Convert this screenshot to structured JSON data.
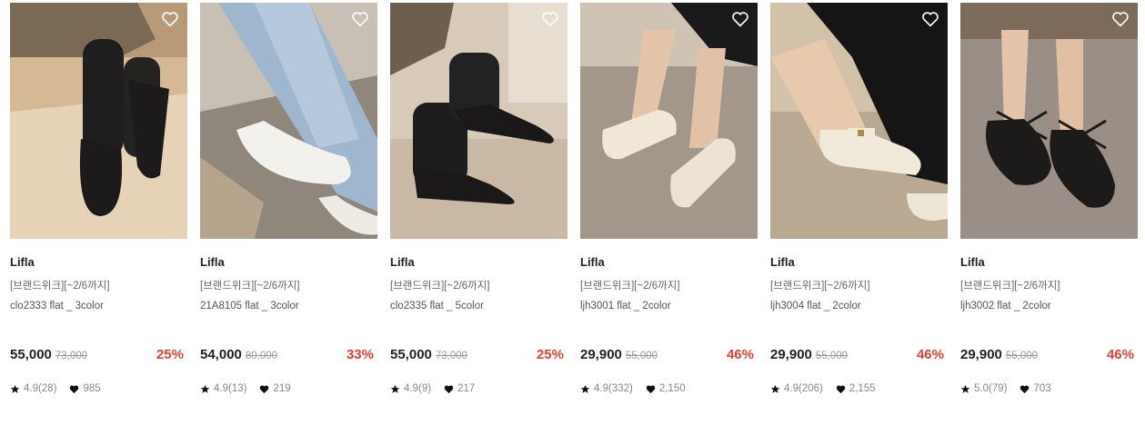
{
  "products": [
    {
      "brand": "Lifla",
      "event": "[브랜드위크][~2/6까지]",
      "name": "clo2333 flat _ 3color",
      "price": "55,000",
      "original_price": "73,000",
      "discount": "25%",
      "rating": "4.9(28)",
      "likes": "985",
      "shoe_color": "#1c1a1a",
      "bg": "#bfa88e"
    },
    {
      "brand": "Lifla",
      "event": "[브랜드위크][~2/6까지]",
      "name": "21A8105 flat _ 3color",
      "price": "54,000",
      "original_price": "80,000",
      "discount": "33%",
      "rating": "4.9(13)",
      "likes": "219",
      "shoe_color": "#f2f0ec",
      "bg": "#a9a199"
    },
    {
      "brand": "Lifla",
      "event": "[브랜드위크][~2/6까지]",
      "name": "clo2335 flat _ 5color",
      "price": "55,000",
      "original_price": "73,000",
      "discount": "25%",
      "rating": "4.9(9)",
      "likes": "217",
      "shoe_color": "#1a1818",
      "bg": "#c9b8a3"
    },
    {
      "brand": "Lifla",
      "event": "[브랜드위크][~2/6까지]",
      "name": "ljh3001 flat _ 2color",
      "price": "29,900",
      "original_price": "55,000",
      "discount": "46%",
      "rating": "4.9(332)",
      "likes": "2,150",
      "shoe_color": "#efe6d6",
      "bg": "#a3968a"
    },
    {
      "brand": "Lifla",
      "event": "[브랜드위크][~2/6까지]",
      "name": "ljh3004 flat _ 2color",
      "price": "29,900",
      "original_price": "55,000",
      "discount": "46%",
      "rating": "4.9(206)",
      "likes": "2,155",
      "shoe_color": "#f1ead9",
      "bg": "#b9a993"
    },
    {
      "brand": "Lifla",
      "event": "[브랜드위크][~2/6까지]",
      "name": "ljh3002 flat _ 2color",
      "price": "29,900",
      "original_price": "55,000",
      "discount": "46%",
      "rating": "5.0(79)",
      "likes": "703",
      "shoe_color": "#1d1a1a",
      "bg": "#9a8f86"
    }
  ],
  "icons": {
    "wishlist": "heart-outline-icon",
    "rating": "star-icon",
    "likes": "heart-icon"
  },
  "colors": {
    "discount": "#e8412f",
    "price": "#222222",
    "muted": "#888888"
  }
}
